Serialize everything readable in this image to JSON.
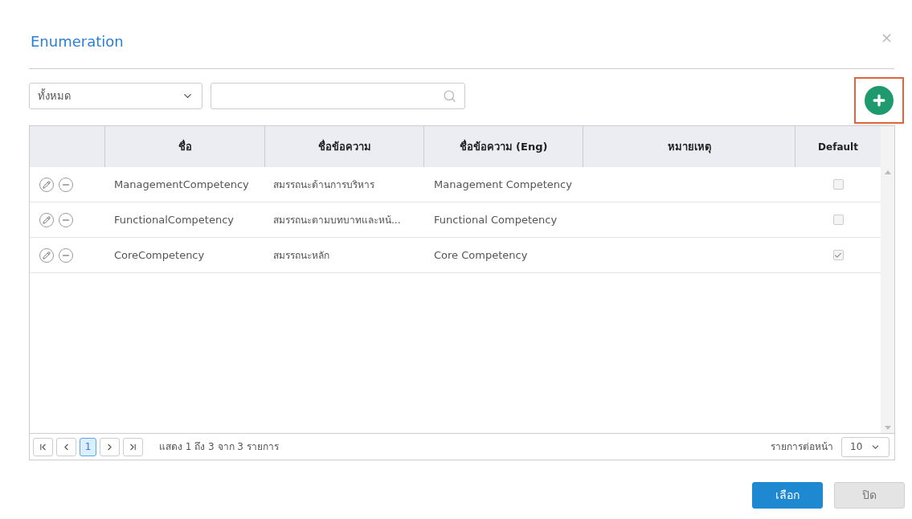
{
  "dialog": {
    "title": "Enumeration",
    "close": "×"
  },
  "filter": {
    "value": "ทั้งหมด"
  },
  "add_button": {
    "highlighted": true
  },
  "table": {
    "columns": [
      "ชื่อ",
      "ชื่อข้อความ",
      "ชื่อข้อความ (Eng)",
      "หมายเหตุ",
      "Default"
    ],
    "rows": [
      {
        "name": "ManagementCompetency",
        "text": "สมรรถนะด้านการบริหาร",
        "text_eng": "Management Competency",
        "default": false
      },
      {
        "name": "FunctionalCompetency",
        "text": "สมรรถนะตามบทบาทและหน้...",
        "text_eng": "Functional Competency",
        "default": false
      },
      {
        "name": "CoreCompetency",
        "text": "สมรรถนะหลัก",
        "text_eng": "Core Competency",
        "default": true
      }
    ]
  },
  "pager": {
    "pages": [
      {
        "label": "1",
        "selected": true
      }
    ],
    "summary": "แสดง 1 ถึง 3 จาก 3 รายการ",
    "per_page_label": "รายการต่อหน้า",
    "per_page": "10"
  },
  "buttons": [
    {
      "label": "เลือก",
      "kind": "primary"
    },
    {
      "label": "ปิด",
      "kind": "secondary"
    }
  ]
}
